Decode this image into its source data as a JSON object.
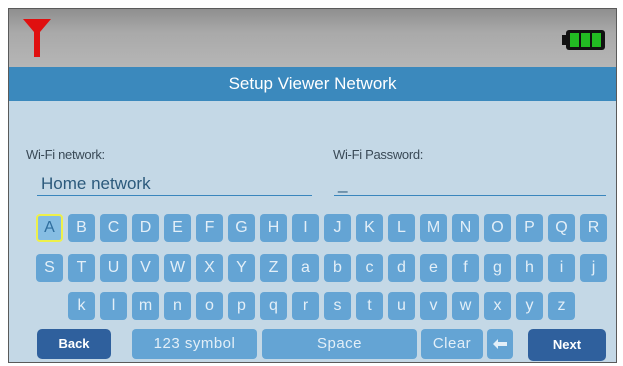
{
  "status": {
    "signal_icon": "red-funnel-antenna-icon",
    "battery_icon": "battery-full-icon",
    "battery_color": "#22bb22"
  },
  "title": "Setup Viewer Network",
  "fields": {
    "network_label": "Wi-Fi network:",
    "network_value": "Home network",
    "password_label": "Wi-Fi Password:",
    "password_value": "_"
  },
  "keyboard": {
    "row1": [
      "A",
      "B",
      "C",
      "D",
      "E",
      "F",
      "G",
      "H",
      "I",
      "J",
      "K",
      "L",
      "M",
      "N",
      "O",
      "P",
      "Q",
      "R"
    ],
    "row2": [
      "S",
      "T",
      "U",
      "V",
      "W",
      "X",
      "Y",
      "Z",
      "a",
      "b",
      "c",
      "d",
      "e",
      "f",
      "g",
      "h",
      "i",
      "j"
    ],
    "row3": [
      "k",
      "l",
      "m",
      "n",
      "o",
      "p",
      "q",
      "r",
      "s",
      "t",
      "u",
      "v",
      "w",
      "x",
      "y",
      "z"
    ],
    "selected_key": "A",
    "back_label": "Back",
    "symbol_label": "123 symbol",
    "space_label": "Space",
    "clear_label": "Clear",
    "backspace_icon": "backspace-arrow-icon",
    "next_label": "Next"
  },
  "colors": {
    "accent": "#3b89bd",
    "key": "#64a4d4",
    "button_dark": "#2f609d",
    "selection": "#eef04a"
  }
}
